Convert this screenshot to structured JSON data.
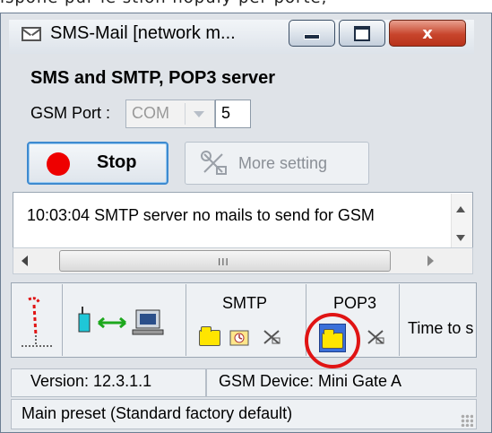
{
  "top_strip_text": "ispone pur le stion nopuly per porte,",
  "window": {
    "title": "SMS-Mail  [network m...",
    "buttons": {
      "close": "x"
    }
  },
  "panel": {
    "title": "SMS and SMTP, POP3 server",
    "gsm_port_label": "GSM Port :",
    "port_type": "COM",
    "port_number": "5",
    "stop_label": "Stop",
    "more_setting_label": "More setting"
  },
  "log": {
    "lines": [
      "10:03:04  SMTP server no mails to send for GSM"
    ]
  },
  "scrollbar": {
    "grip": "III"
  },
  "status_icons": {
    "smtp_label": "SMTP",
    "pop3_label": "POP3",
    "time_label": "Time to s"
  },
  "status_bar": {
    "version": "Version: 12.3.1.1",
    "device": "GSM Device: Mini Gate A",
    "preset": "Main preset (Standard factory default)"
  },
  "colors": {
    "stop_dot": "#ee0000",
    "highlight_circle": "#e01414",
    "folder": "#ffe500"
  }
}
